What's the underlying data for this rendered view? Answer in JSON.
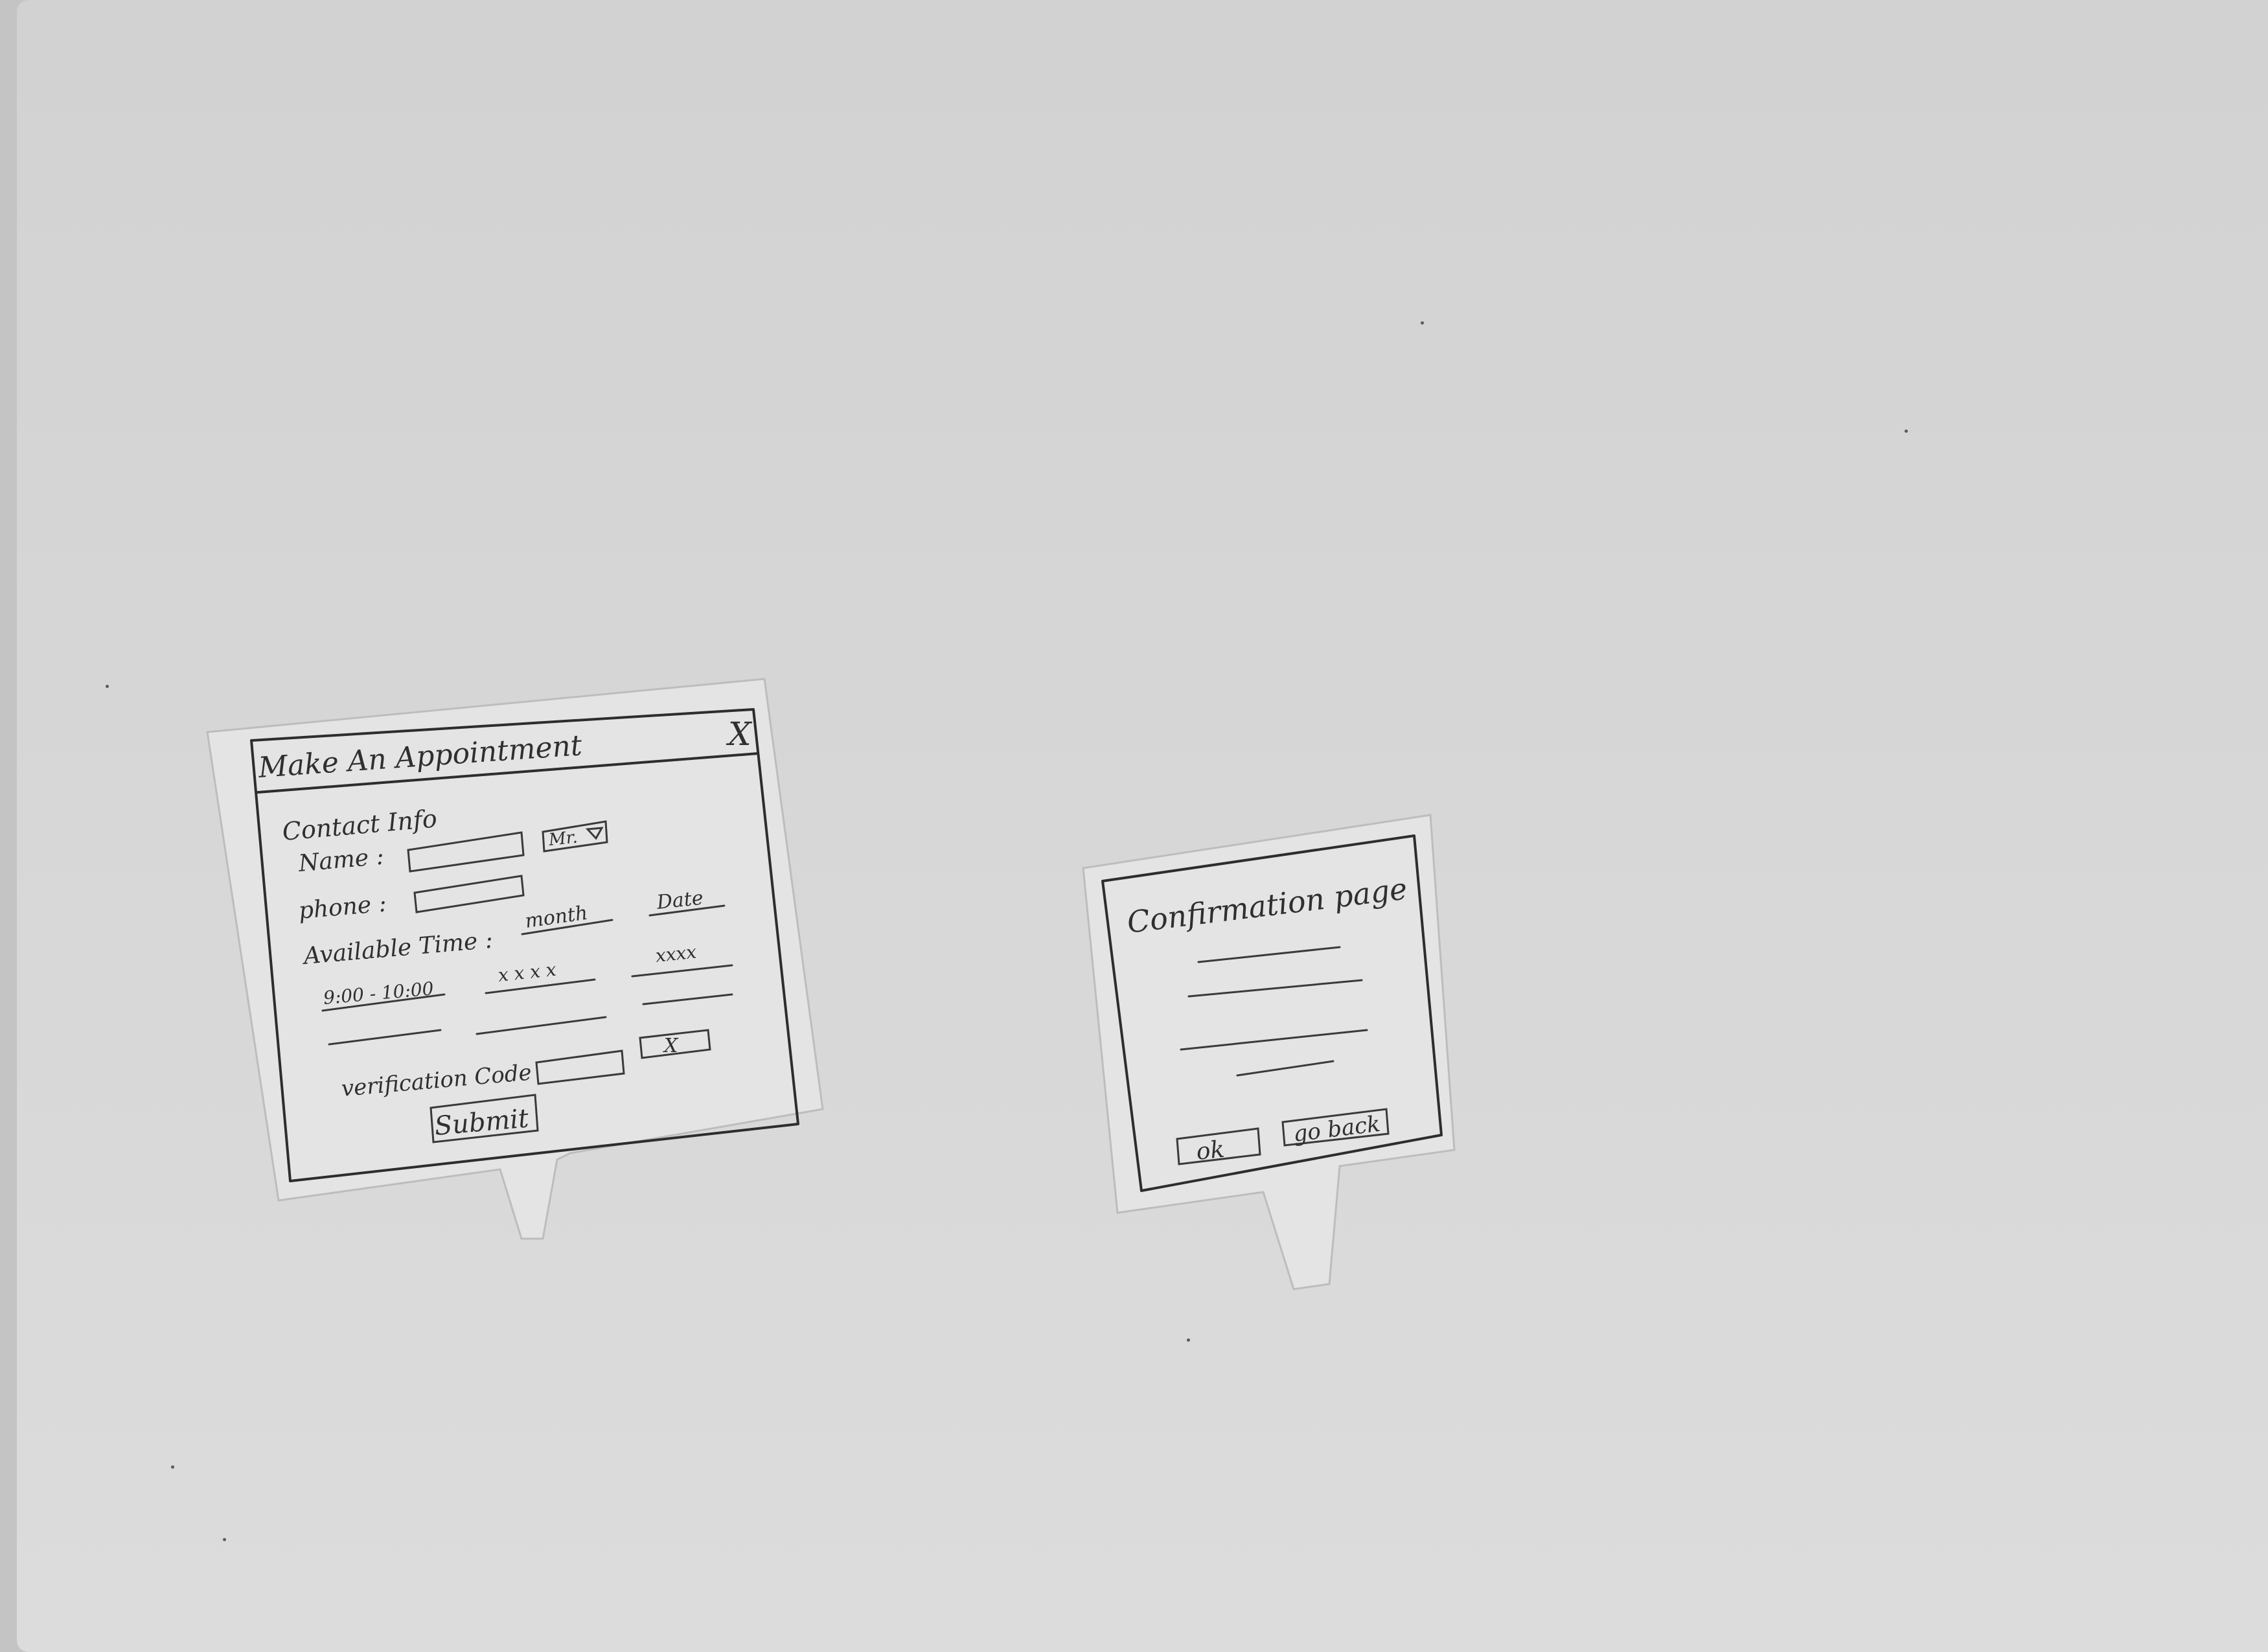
{
  "appointment_dialog": {
    "title": "Make An Appointment",
    "close_glyph": "X",
    "section_heading": "Contact Info",
    "name_label": "Name :",
    "salutation_value": "Mr.",
    "phone_label": "phone :",
    "available_time_label": "Available Time :",
    "time_columns": [
      "month",
      "Date"
    ],
    "time_row_values": [
      "9:00 - 10:00",
      "x x x x",
      "xxxx"
    ],
    "verification_label": "verification Code",
    "captcha_glyph": "X",
    "submit_label": "Submit"
  },
  "confirmation_dialog": {
    "title": "Confirmation page",
    "ok_label": "ok",
    "go_back_label": "go back"
  }
}
